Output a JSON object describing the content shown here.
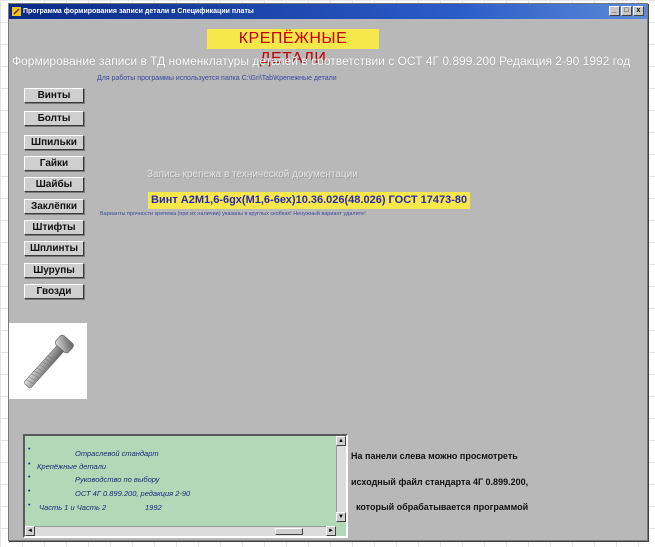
{
  "window": {
    "title": "Программа формирования записи детали в Спецификации платы"
  },
  "title_buttons": [
    "_",
    "□",
    "x"
  ],
  "heading": "КРЕПЁЖНЫЕ ДЕТАЛИ",
  "subheading": "Формирование записи в ТД номенклатуры деталей в соответствии с ОСТ 4Г 0.899.200   Редакция 2-90   1992 год",
  "folder_note": "Для работы программы используется папка  C:\\Gri\\Tab\\Крепежные детали",
  "categories": [
    "Винты",
    "Болты",
    "Шпильки",
    "Гайки",
    "Шайбы",
    "Заклёпки",
    "Штифты",
    "Шплинты",
    "Шурупы",
    "Гвозди"
  ],
  "record": {
    "caption": "Запись крепежа в технической документации",
    "value": "Винт А2М1,6-6gх(М1,6-6ех)10.36.026(48.026) ГОСТ 17473-80",
    "variants_note": "Варианты прочности крепежа  (при их наличии) указаны в круглых скобках! Ненужный вариант удалите!"
  },
  "doc_panel": {
    "lines": [
      "Отраслевой стандарт",
      "Крепёжные детали",
      "Руководство по выбору",
      "ОСТ 4Г 0.899.200, редакция 2-90",
      "Часть 1 и Часть 2",
      "1992"
    ],
    "scroll_up": "▲",
    "scroll_down": "▼",
    "scroll_left": "◄",
    "scroll_right": "►"
  },
  "info": {
    "line1": "На панели слева можно просмотреть",
    "line2": "исходный файл стандарта 4Г 0.899.200,",
    "line3": "который обрабатывается программой"
  },
  "colors": {
    "heading_bg": "#f6e84a",
    "heading_text": "#c00000",
    "window_bg": "#b8b8b8",
    "doc_panel_bg": "#b3d8b8",
    "record_text": "#2a2ab0"
  },
  "preview_icon": "screw-image"
}
